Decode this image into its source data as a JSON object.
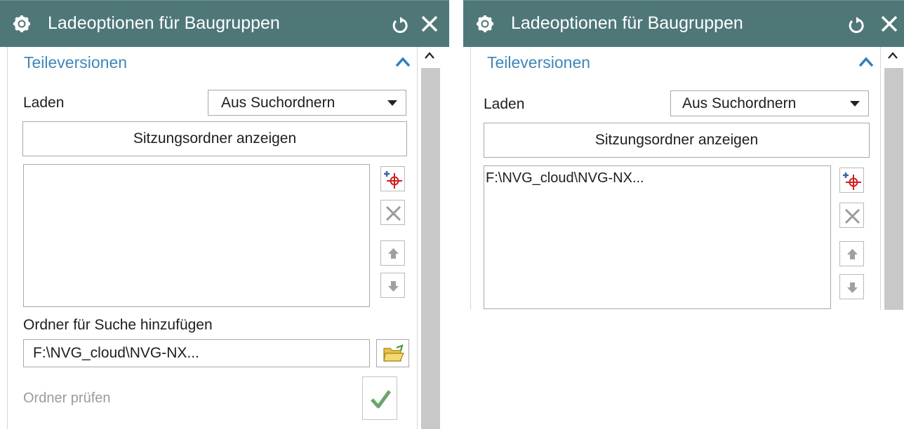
{
  "colors": {
    "titlebar_bg": "#4f7778",
    "section_title": "#3f86b8",
    "scroll_thumb": "#c8c8c8",
    "disabled_text": "#9a9a9a",
    "check_green": "#6aa56a"
  },
  "panels": [
    {
      "title": "Ladeoptionen für Baugruppen",
      "section_title": "Teileversionen",
      "load_label": "Laden",
      "load_value": "Aus Suchordnern",
      "session_button": "Sitzungsordner anzeigen",
      "list_items": [],
      "add_folder_label": "Ordner für Suche hinzufügen",
      "folder_value": "F:\\NVG_cloud\\NVG-NX...",
      "check_label": "Ordner prüfen",
      "icons": [
        "gear-icon",
        "reset-icon",
        "close-icon",
        "chevron-up-icon",
        "add-folder-icon",
        "remove-icon",
        "move-up-icon",
        "move-down-icon",
        "open-folder-icon",
        "checkmark-icon"
      ]
    },
    {
      "title": "Ladeoptionen für Baugruppen",
      "section_title": "Teileversionen",
      "load_label": "Laden",
      "load_value": "Aus Suchordnern",
      "session_button": "Sitzungsordner anzeigen",
      "list_items": [
        "F:\\NVG_cloud\\NVG-NX..."
      ]
    }
  ]
}
